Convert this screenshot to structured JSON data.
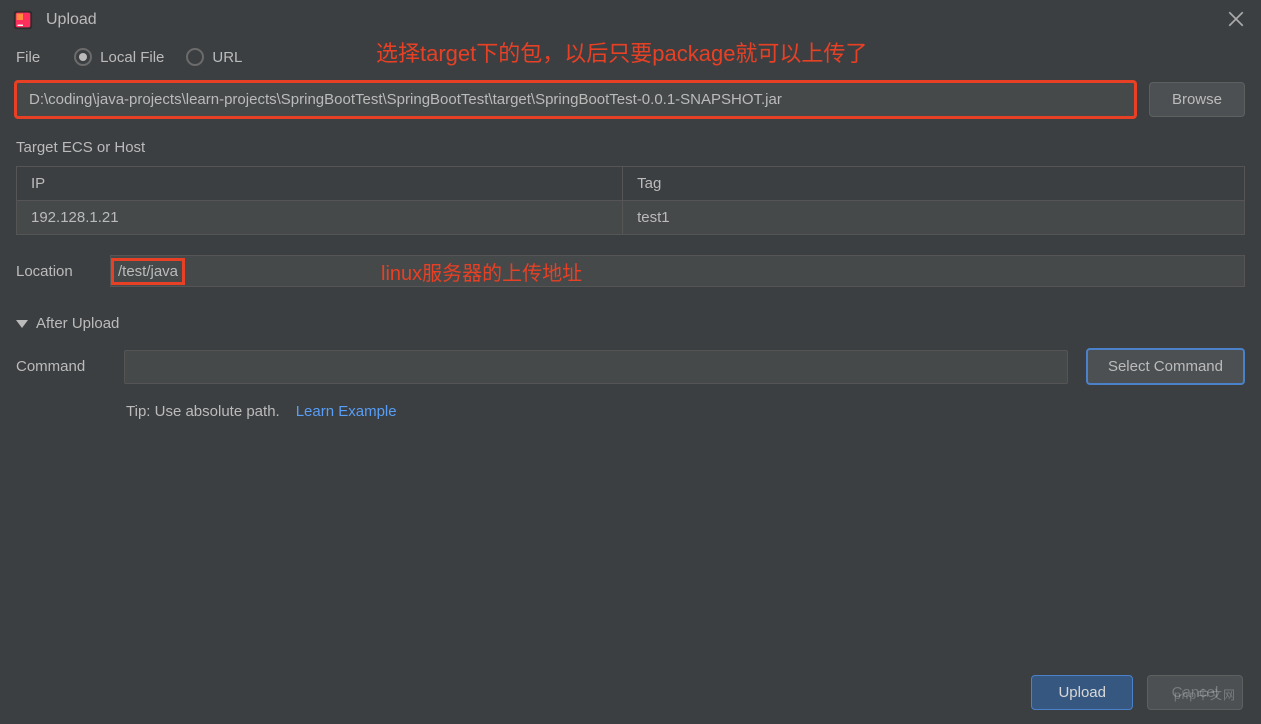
{
  "titlebar": {
    "title": "Upload"
  },
  "file": {
    "label": "File",
    "local_file_label": "Local File",
    "url_label": "URL",
    "path_value": "D:\\coding\\java-projects\\learn-projects\\SpringBootTest\\SpringBootTest\\target\\SpringBootTest-0.0.1-SNAPSHOT.jar",
    "browse_label": "Browse"
  },
  "annotations": {
    "top": "选择target下的包，以后只要package就可以上传了",
    "location": "linux服务器的上传地址"
  },
  "target": {
    "label": "Target ECS or Host",
    "headers": {
      "ip": "IP",
      "tag": "Tag"
    },
    "rows": [
      {
        "ip": "192.128.1.21",
        "tag": "test1"
      }
    ]
  },
  "location": {
    "label": "Location",
    "value": "/test/java"
  },
  "after_upload": {
    "label": "After Upload"
  },
  "command": {
    "label": "Command",
    "value": "",
    "select_label": "Select Command"
  },
  "tip": {
    "text": "Tip: Use absolute path.",
    "link": "Learn Example"
  },
  "footer": {
    "upload": "Upload",
    "cancel": "Cancel"
  },
  "watermark": "php中文网"
}
